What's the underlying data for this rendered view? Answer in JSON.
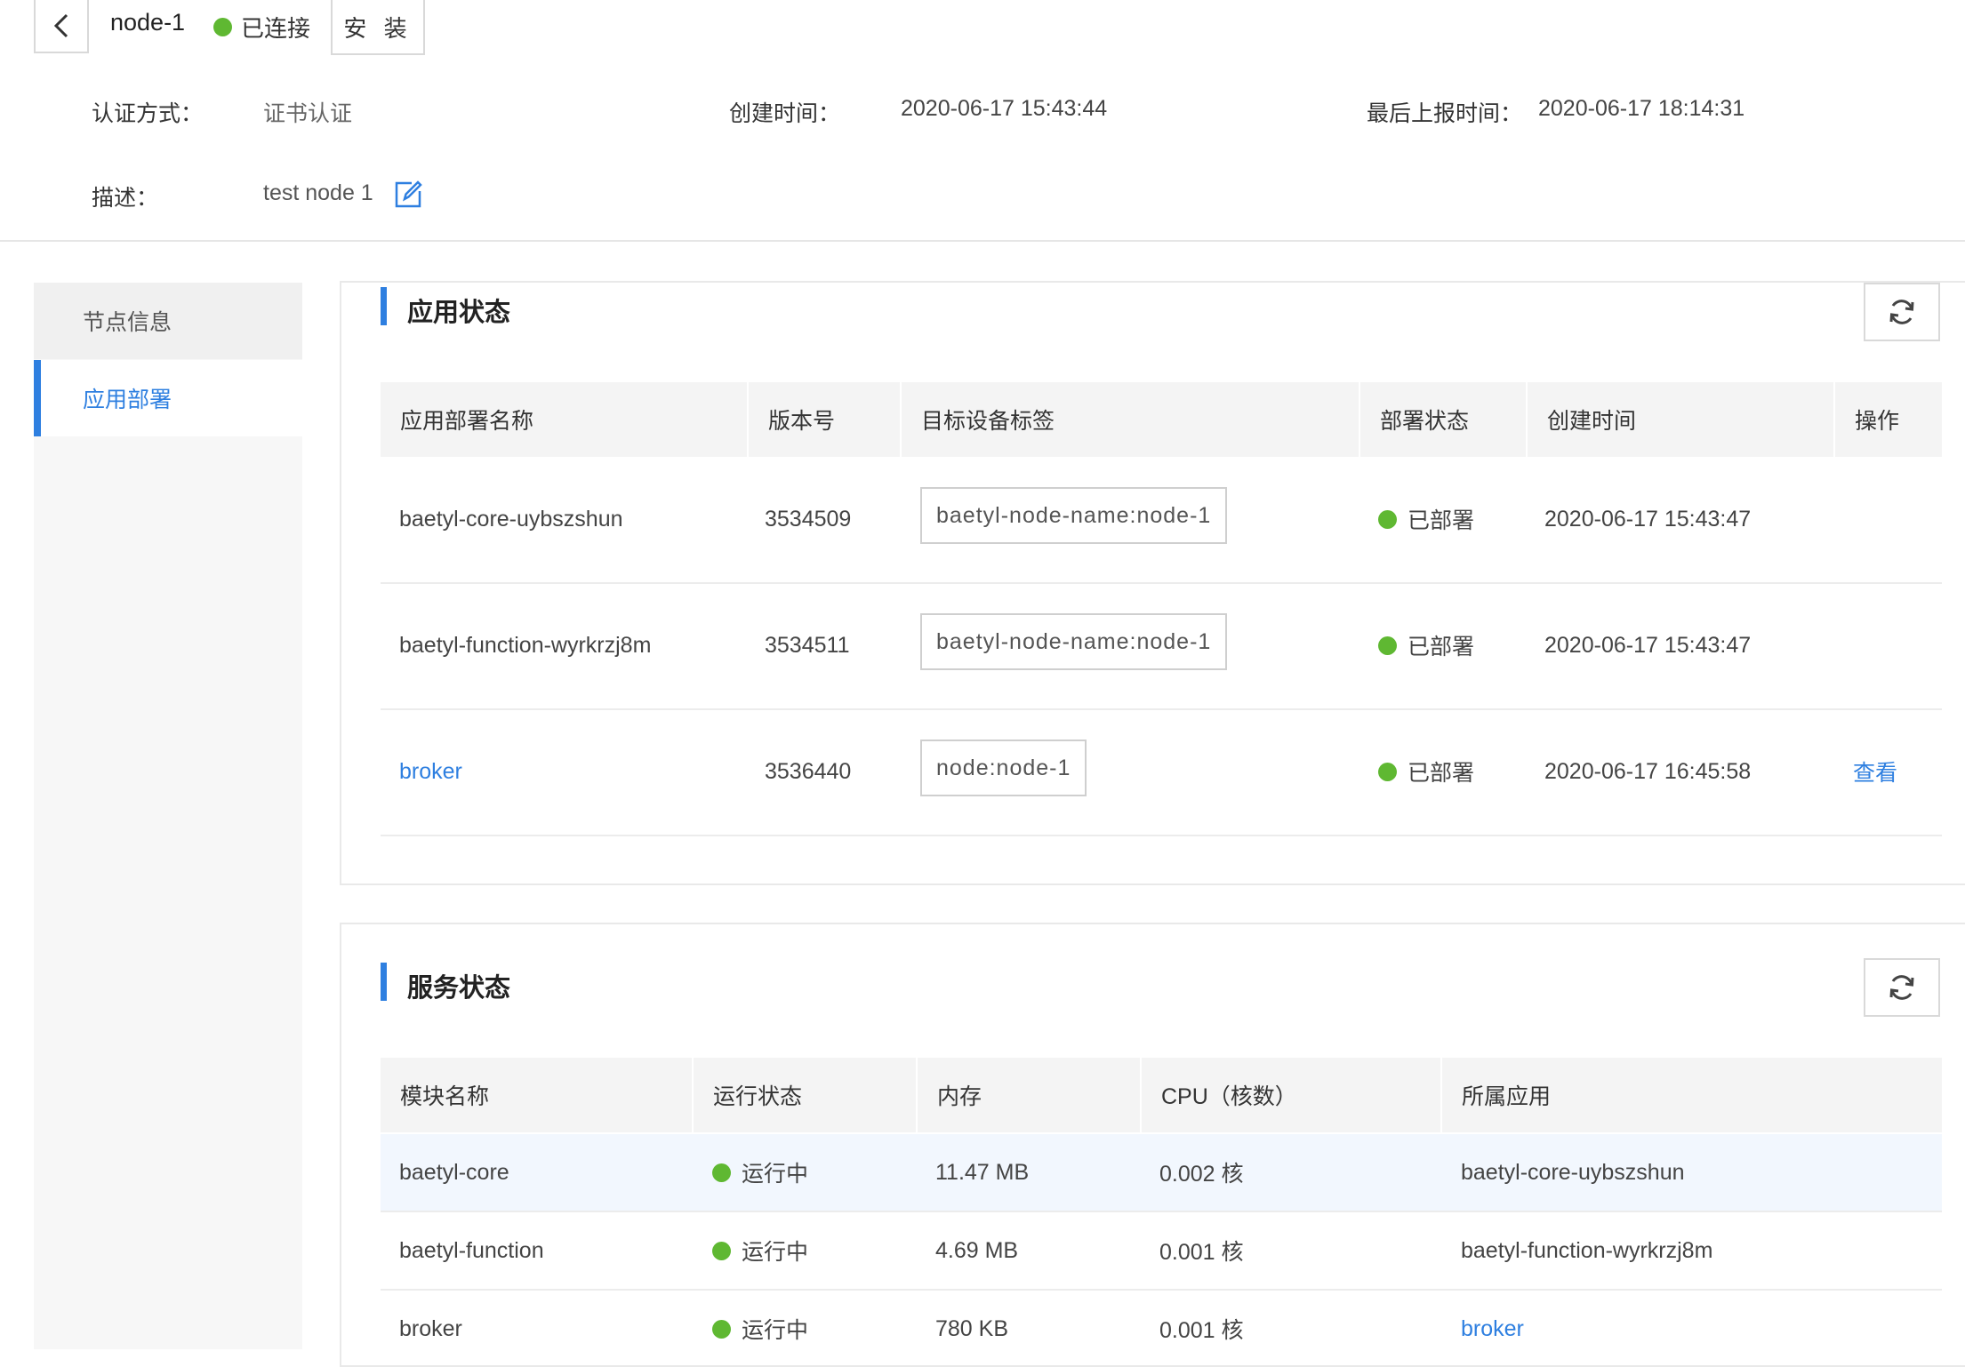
{
  "header": {
    "node_name": "node-1",
    "connection_status": "已连接",
    "install_label": "安 装",
    "auth_label": "认证方式：",
    "auth_value": "证书认证",
    "created_label": "创建时间：",
    "created_value": "2020-06-17 15:43:44",
    "reported_label": "最后上报时间：",
    "reported_value": "2020-06-17 18:14:31",
    "desc_label": "描述：",
    "desc_value": "test node 1"
  },
  "sidebar": {
    "items": [
      {
        "label": "节点信息"
      },
      {
        "label": "应用部署"
      }
    ]
  },
  "app_status": {
    "title": "应用状态",
    "columns": [
      "应用部署名称",
      "版本号",
      "目标设备标签",
      "部署状态",
      "创建时间",
      "操作"
    ],
    "rows": [
      {
        "name": "baetyl-core-uybszshun",
        "version": "3534509",
        "tag": "baetyl-node-name:node-1",
        "status": "已部署",
        "created": "2020-06-17 15:43:47",
        "action": ""
      },
      {
        "name": "baetyl-function-wyrkrzj8m",
        "version": "3534511",
        "tag": "baetyl-node-name:node-1",
        "status": "已部署",
        "created": "2020-06-17 15:43:47",
        "action": ""
      },
      {
        "name": "broker",
        "version": "3536440",
        "tag": "node:node-1",
        "status": "已部署",
        "created": "2020-06-17 16:45:58",
        "action": "查看"
      }
    ]
  },
  "service_status": {
    "title": "服务状态",
    "columns": [
      "模块名称",
      "运行状态",
      "内存",
      "CPU（核数）",
      "所属应用"
    ],
    "rows": [
      {
        "module": "baetyl-core",
        "status": "运行中",
        "memory": "11.47 MB",
        "cpu": "0.002 核",
        "app": "baetyl-core-uybszshun"
      },
      {
        "module": "baetyl-function",
        "status": "运行中",
        "memory": "4.69 MB",
        "cpu": "0.001 核",
        "app": "baetyl-function-wyrkrzj8m"
      },
      {
        "module": "broker",
        "status": "运行中",
        "memory": "780 KB",
        "cpu": "0.001 核",
        "app": "broker"
      }
    ]
  },
  "colors": {
    "accent": "#2e7fe0",
    "status_green": "#5fb832",
    "header_bg": "#f4f4f4"
  }
}
